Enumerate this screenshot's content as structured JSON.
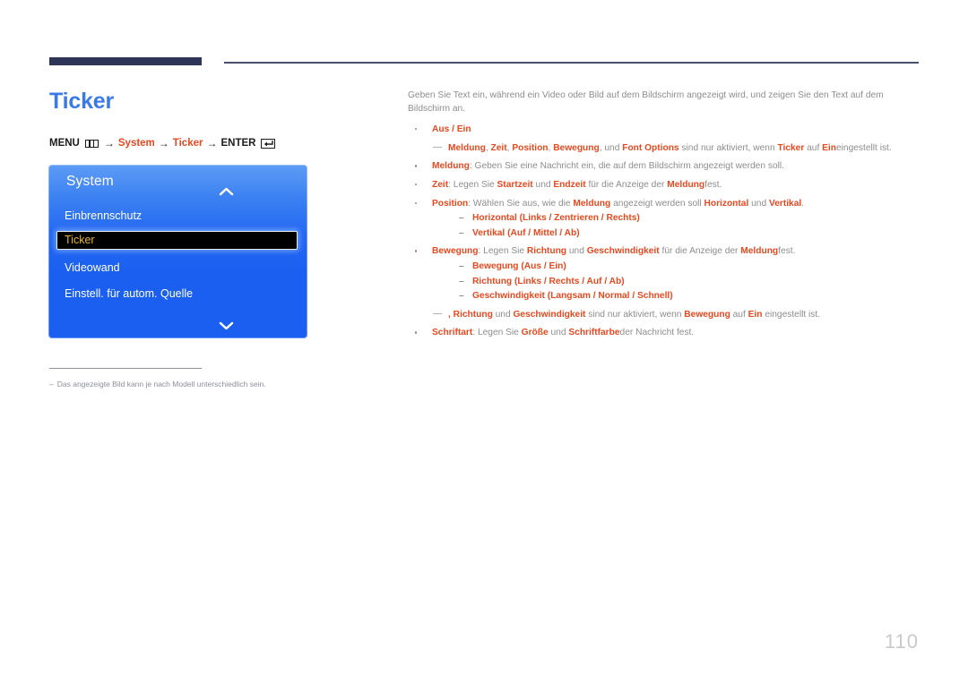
{
  "page": {
    "title": "Ticker",
    "number": "110",
    "title_color": "#3a7ae8",
    "accent_color": "#e8481f",
    "rule_color": "#2e3557"
  },
  "menu_path": {
    "menu_label": "MENU",
    "menu_icon": "menu-bars-icon",
    "arrow": "→",
    "step1": "System",
    "step2": "Ticker",
    "enter_label": "ENTER",
    "enter_icon": "enter-return-icon"
  },
  "osd": {
    "header": "System",
    "chevron_up_icon": "chevron-up-icon",
    "chevron_down_icon": "chevron-down-icon",
    "items": [
      {
        "label": "Einbrennschutz",
        "selected": false
      },
      {
        "label": "Ticker",
        "selected": true
      },
      {
        "label": "Videowand",
        "selected": false
      },
      {
        "label": "Einstell. für autom. Quelle",
        "selected": false
      }
    ],
    "selected_text_color": "#e8b42a",
    "background_color": "#1a5ff0"
  },
  "footnote": {
    "dash": "–",
    "text": "Das angezeigte Bild kann je nach Modell unterschiedlich sein."
  },
  "content": {
    "intro": "Geben Sie Text ein, während ein Video oder Bild auf dem Bildschirm angezeigt wird, und zeigen Sie den Text auf dem Bildschirm an.",
    "b1_title": "Aus / Ein",
    "b1_note_a": "Meldung",
    "b1_note_b": ", ",
    "b1_note_c": "Zeit",
    "b1_note_d": ", ",
    "b1_note_e": "Position",
    "b1_note_f": ", ",
    "b1_note_g": "Bewegung",
    "b1_note_h": ", und ",
    "b1_note_i": "Font Options",
    "b1_note_j": " sind nur aktiviert, wenn ",
    "b1_note_k": "Ticker",
    "b1_note_l": " auf ",
    "b1_note_m": "Ein",
    "b1_note_n": "eingestellt ist.",
    "b2_term": "Meldung",
    "b2_rest": ": Geben Sie eine Nachricht ein, die auf dem Bildschirm angezeigt werden soll.",
    "b3_term": "Zeit",
    "b3_a": ": Legen Sie ",
    "b3_b": "Startzeit",
    "b3_c": " und ",
    "b3_d": "Endzeit",
    "b3_e": " für die Anzeige der ",
    "b3_f": "Meldung",
    "b3_g": "fest.",
    "b4_term": "Position",
    "b4_a": ": Wählen Sie aus, wie die ",
    "b4_b": "Meldung",
    "b4_c": " angezeigt werden soll ",
    "b4_d": "Horizontal",
    "b4_e": " und ",
    "b4_f": "Vertikal",
    "b4_g": ".",
    "b4_sub1_term": "Horizontal",
    "b4_sub1_opts": "(Links / Zentrieren / Rechts)",
    "b4_sub2_term": "Vertikal",
    "b4_sub2_opts": "(Auf / Mittel / Ab)",
    "b5_term": "Bewegung",
    "b5_a": ": Legen Sie ",
    "b5_b": "Richtung",
    "b5_c": " und ",
    "b5_d": "Geschwindigkeit",
    "b5_e": " für die Anzeige der ",
    "b5_f": "Meldung",
    "b5_g": "fest.",
    "b5_sub1_term": "Bewegung",
    "b5_sub1_opts": "(Aus / Ein)",
    "b5_sub2_term": "Richtung",
    "b5_sub2_opts": "(Links / Rechts / Auf / Ab)",
    "b5_sub3_term": "Geschwindigkeit",
    "b5_sub3_opts": "(Langsam / Normal / Schnell)",
    "b5_note_a": ", ",
    "b5_note_b": "Richtung",
    "b5_note_c": " und ",
    "b5_note_d": "Geschwindigkeit",
    "b5_note_e": " sind nur aktiviert, wenn ",
    "b5_note_f": "Bewegung",
    "b5_note_g": " auf ",
    "b5_note_h": "Ein",
    "b5_note_i": " eingestellt ist.",
    "b6_term": "Schriftart",
    "b6_a": ": Legen Sie ",
    "b6_b": "Größe",
    "b6_c": " und ",
    "b6_d": "Schriftfarbe",
    "b6_e": "der Nachricht fest."
  }
}
